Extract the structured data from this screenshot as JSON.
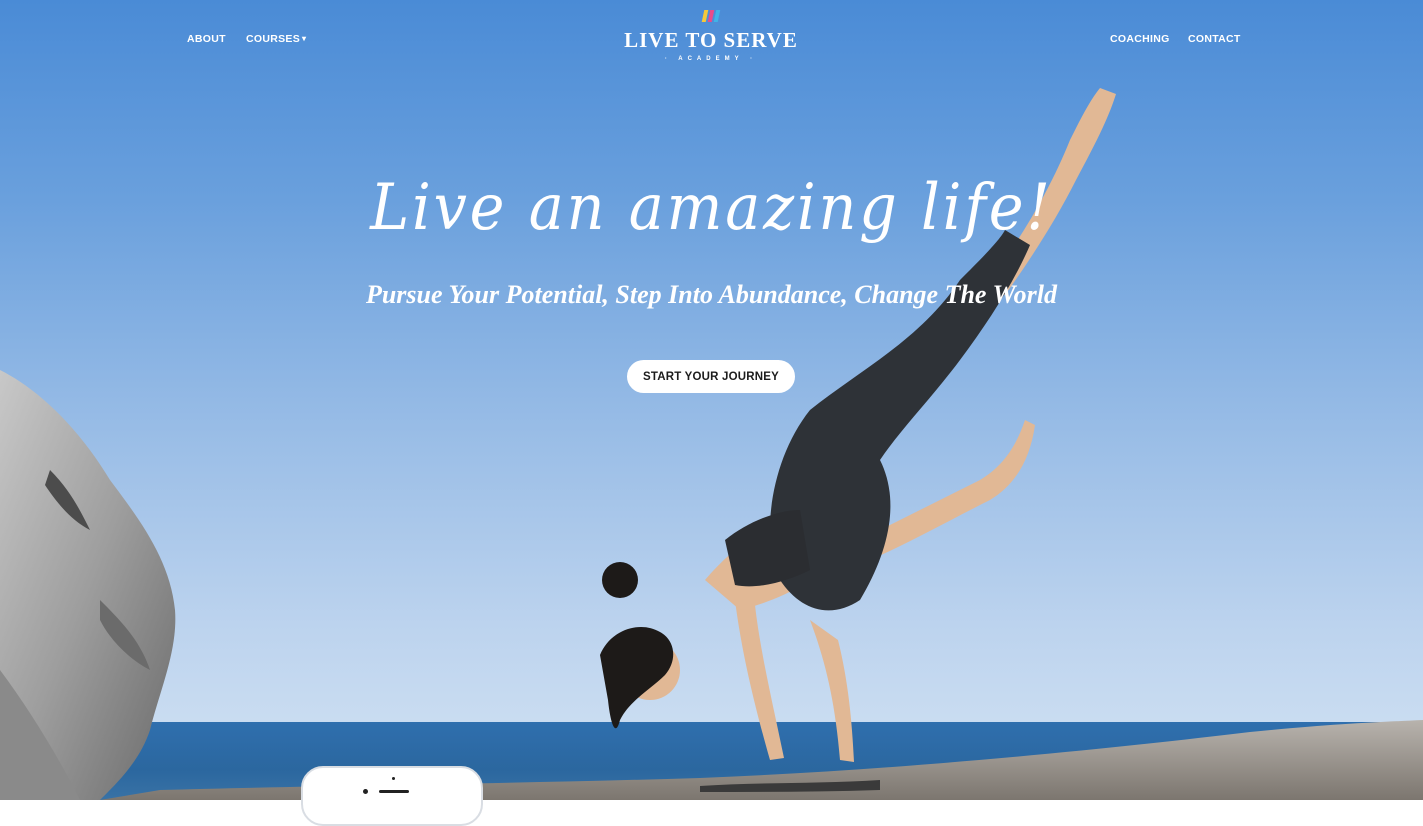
{
  "brand": {
    "title_main": "LIVE TO SERVE",
    "subtitle": "· ACADEMY ·",
    "mark_colors": [
      "#f5c93a",
      "#e84c8b",
      "#3fb3e8"
    ]
  },
  "nav": {
    "about": "ABOUT",
    "courses": "COURSES",
    "coaching": "COACHING",
    "contact": "CONTACT"
  },
  "hero": {
    "headline": "Live an amazing life!",
    "tagline": "Pursue Your Potential, Step Into Abundance, Change The World",
    "cta": "START YOUR JOURNEY"
  },
  "icons": {
    "courses_dropdown": "caret-down-icon",
    "phone": "phone-device-icon"
  },
  "colors": {
    "sky_top": "#4a8bd6",
    "sky_bottom": "#c9dcf1",
    "sea": "#2f6fae",
    "button_bg": "#ffffff",
    "button_text": "#1c1c1c"
  }
}
